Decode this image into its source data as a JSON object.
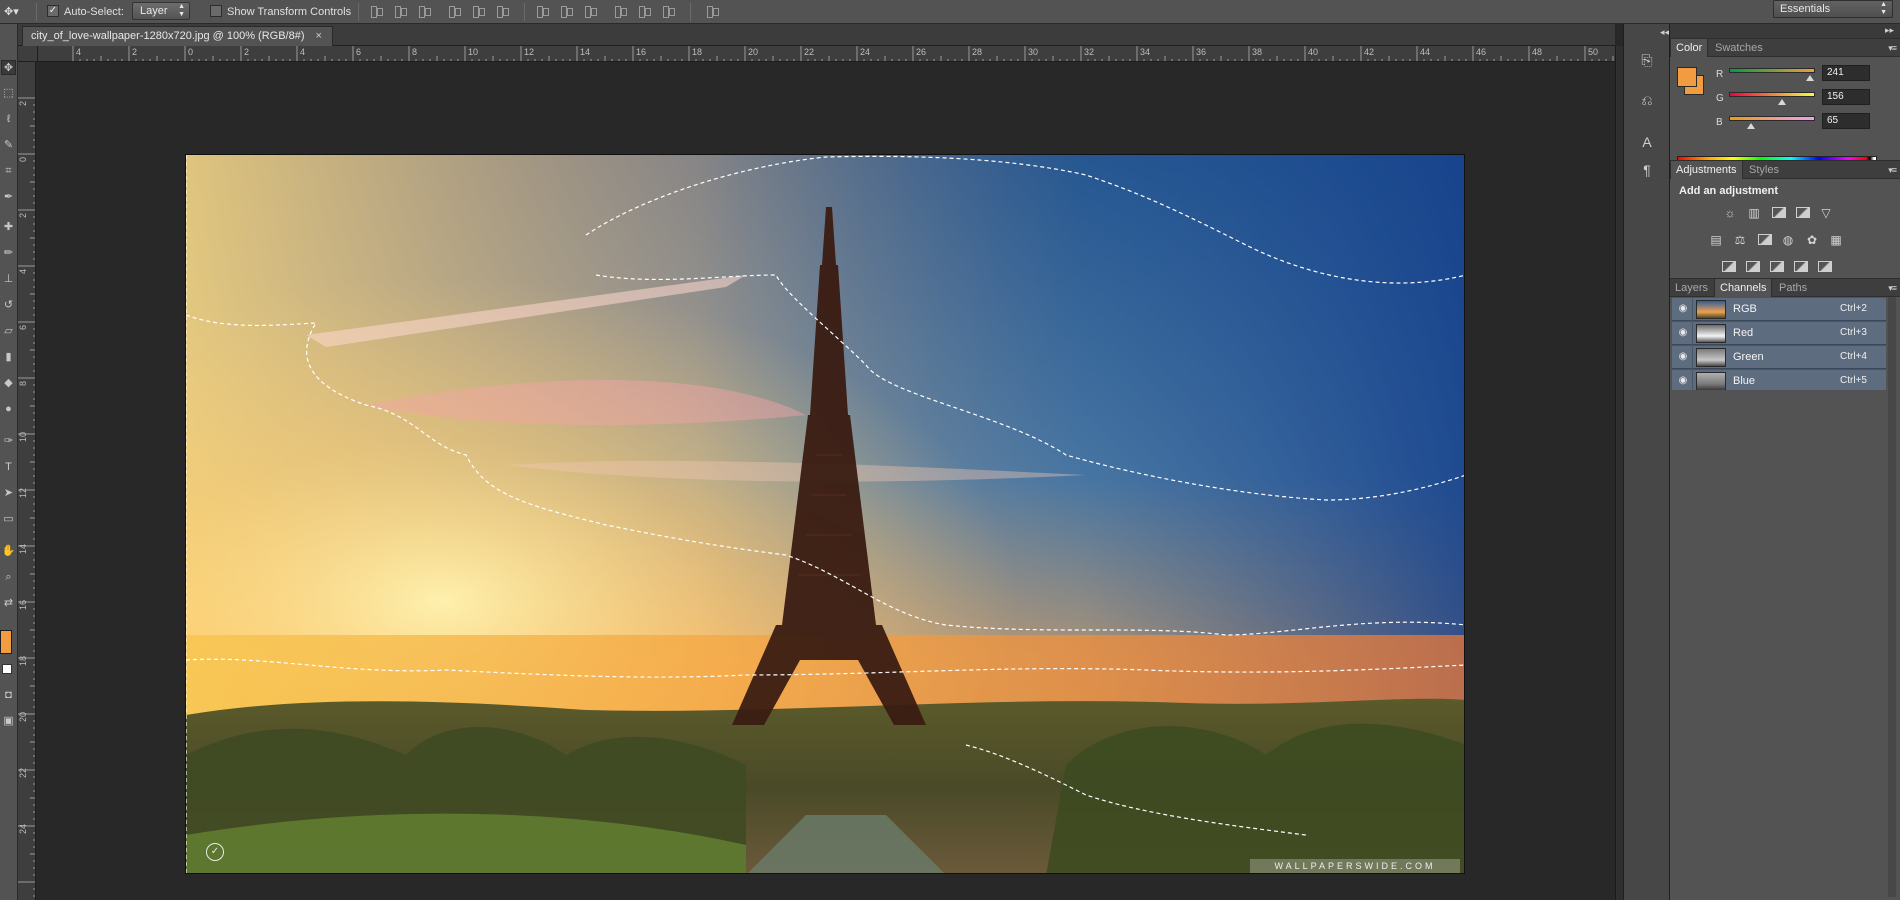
{
  "options_bar": {
    "auto_select_label": "Auto-Select:",
    "auto_select_checked": true,
    "auto_select_target": "Layer",
    "show_transform_label": "Show Transform Controls",
    "show_transform_checked": false
  },
  "workspace": {
    "label": "Essentials"
  },
  "document": {
    "tab_title": "city_of_love-wallpaper-1280x720.jpg @ 100% (RGB/8#)",
    "close_glyph": "×",
    "watermark": "WALLPAPERSWIDE.COM",
    "logo_glyph": "✓"
  },
  "rulers": {
    "horizontal_labels": [
      "4",
      "2",
      "0",
      "2",
      "4",
      "6",
      "8",
      "10",
      "12",
      "14",
      "16",
      "18",
      "20",
      "22",
      "24",
      "26",
      "28",
      "30",
      "32",
      "34",
      "36",
      "38",
      "40",
      "42",
      "44",
      "46",
      "48",
      "50"
    ],
    "vertical_labels": [
      "2",
      "0",
      "2",
      "4",
      "6",
      "8",
      "10",
      "12",
      "14",
      "16",
      "18",
      "20",
      "22",
      "24"
    ]
  },
  "tools": {
    "icons": [
      "move-icon",
      "marquee-icon",
      "lasso-icon",
      "quick-select-icon",
      "crop-icon",
      "eyedropper-icon",
      "healing-icon",
      "brush-icon",
      "stamp-icon",
      "history-brush-icon",
      "eraser-icon",
      "gradient-icon",
      "blur-icon",
      "dodge-icon",
      "pen-icon",
      "type-icon",
      "path-select-icon",
      "shape-icon",
      "hand-icon",
      "zoom-icon"
    ],
    "foreground_color": "#f19c41",
    "background_color": "#ffffff"
  },
  "color_panel": {
    "tabs": [
      "Color",
      "Swatches"
    ],
    "active_tab": "Color",
    "foreground_hex": "#f19c41",
    "channels": [
      {
        "label": "R",
        "value": "241",
        "fraction": 0.945
      },
      {
        "label": "G",
        "value": "156",
        "fraction": 0.612
      },
      {
        "label": "B",
        "value": "65",
        "fraction": 0.255
      }
    ]
  },
  "adjustments_panel": {
    "tabs": [
      "Adjustments",
      "Styles"
    ],
    "active_tab": "Adjustments",
    "title": "Add an adjustment"
  },
  "layers_panel": {
    "tabs": [
      "Layers",
      "Channels",
      "Paths"
    ],
    "active_tab": "Channels",
    "channels": [
      {
        "name": "RGB",
        "shortcut": "Ctrl+2"
      },
      {
        "name": "Red",
        "shortcut": "Ctrl+3"
      },
      {
        "name": "Green",
        "shortcut": "Ctrl+4"
      },
      {
        "name": "Blue",
        "shortcut": "Ctrl+5"
      }
    ]
  },
  "colors": {
    "panel_bg": "#535353",
    "canvas_bg": "#282828",
    "selection_highlight": "#5e6c80",
    "accent_orange": "#f19c41"
  }
}
